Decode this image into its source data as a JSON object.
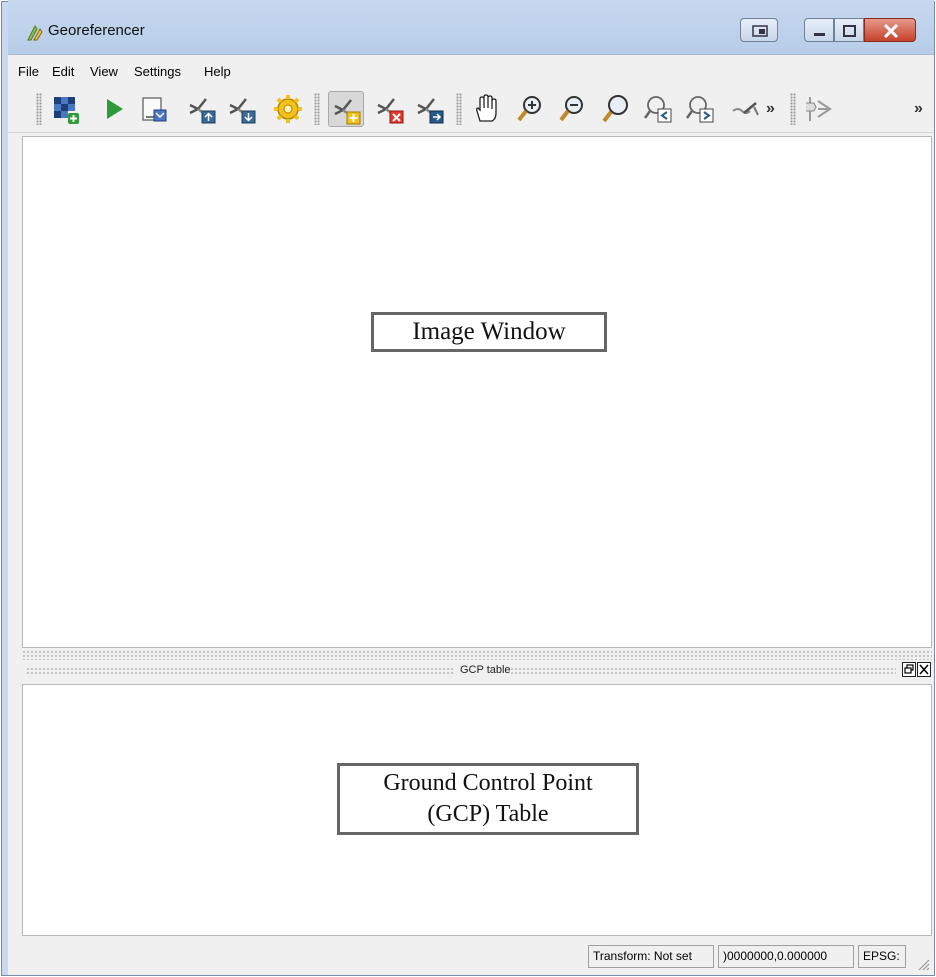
{
  "window": {
    "title": "Georeferencer",
    "accent": "#b7cde8",
    "controls": [
      "restore-icon",
      "minimize-icon",
      "maximize-icon",
      "close-icon"
    ]
  },
  "menubar": {
    "items": [
      "File",
      "Edit",
      "View",
      "Settings",
      "Help"
    ]
  },
  "toolbar": {
    "tools": [
      {
        "icon": "open-raster-icon"
      },
      {
        "icon": "start-georeferencing-icon"
      },
      {
        "icon": "generate-script-icon"
      },
      {
        "icon": "load-gcp-points-icon"
      },
      {
        "icon": "save-gcp-points-icon"
      },
      {
        "icon": "transformation-settings-icon"
      },
      {
        "icon": "add-point-icon",
        "active": true
      },
      {
        "icon": "delete-point-icon"
      },
      {
        "icon": "move-gcp-point-icon"
      },
      {
        "icon": "pan-icon"
      },
      {
        "icon": "zoom-in-icon"
      },
      {
        "icon": "zoom-out-icon"
      },
      {
        "icon": "zoom-to-layer-icon"
      },
      {
        "icon": "zoom-last-icon"
      },
      {
        "icon": "zoom-next-icon"
      },
      {
        "icon": "link-georeferencer-icon"
      },
      {
        "icon": "link-qgis-icon"
      }
    ],
    "overflow_1": "»",
    "overflow_2": "»"
  },
  "image_window": {
    "label": "Image Window"
  },
  "gcp_dock": {
    "title": "GCP table",
    "label_line1": "Ground Control Point",
    "label_line2": "(GCP) Table"
  },
  "statusbar": {
    "transform": "Transform: Not set",
    "coords": ")0000000,0.000000",
    "epsg": "EPSG:"
  }
}
